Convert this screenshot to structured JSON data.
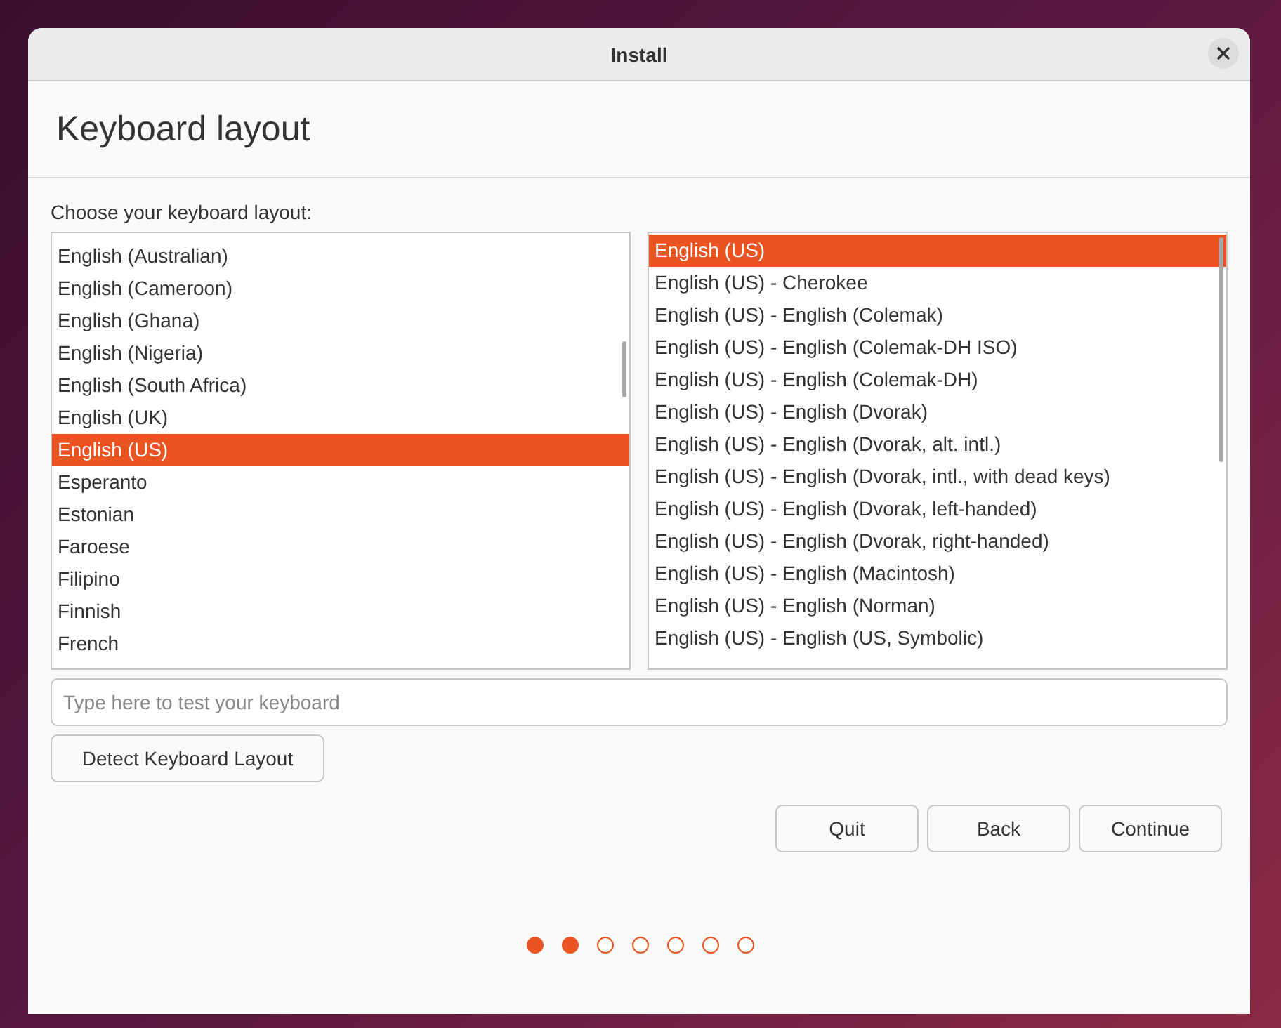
{
  "window": {
    "title": "Install"
  },
  "heading": "Keyboard layout",
  "prompt": "Choose your keyboard layout:",
  "layouts": [
    {
      "label": "English (Australian)",
      "selected": false
    },
    {
      "label": "English (Cameroon)",
      "selected": false
    },
    {
      "label": "English (Ghana)",
      "selected": false
    },
    {
      "label": "English (Nigeria)",
      "selected": false
    },
    {
      "label": "English (South Africa)",
      "selected": false
    },
    {
      "label": "English (UK)",
      "selected": false
    },
    {
      "label": "English (US)",
      "selected": true
    },
    {
      "label": "Esperanto",
      "selected": false
    },
    {
      "label": "Estonian",
      "selected": false
    },
    {
      "label": "Faroese",
      "selected": false
    },
    {
      "label": "Filipino",
      "selected": false
    },
    {
      "label": "Finnish",
      "selected": false
    },
    {
      "label": "French",
      "selected": false
    }
  ],
  "variants": [
    {
      "label": "English (US)",
      "selected": true
    },
    {
      "label": "English (US) - Cherokee",
      "selected": false
    },
    {
      "label": "English (US) - English (Colemak)",
      "selected": false
    },
    {
      "label": "English (US) - English (Colemak-DH ISO)",
      "selected": false
    },
    {
      "label": "English (US) - English (Colemak-DH)",
      "selected": false
    },
    {
      "label": "English (US) - English (Dvorak)",
      "selected": false
    },
    {
      "label": "English (US) - English (Dvorak, alt. intl.)",
      "selected": false
    },
    {
      "label": "English (US) - English (Dvorak, intl., with dead keys)",
      "selected": false
    },
    {
      "label": "English (US) - English (Dvorak, left-handed)",
      "selected": false
    },
    {
      "label": "English (US) - English (Dvorak, right-handed)",
      "selected": false
    },
    {
      "label": "English (US) - English (Macintosh)",
      "selected": false
    },
    {
      "label": "English (US) - English (Norman)",
      "selected": false
    },
    {
      "label": "English (US) - English (US, Symbolic)",
      "selected": false
    }
  ],
  "test_field": {
    "placeholder": "Type here to test your keyboard"
  },
  "detect_button": "Detect Keyboard Layout",
  "buttons": [
    "Quit",
    "Back",
    "Continue"
  ],
  "steps": [
    {
      "done": true
    },
    {
      "done": true
    },
    {
      "done": false
    },
    {
      "done": false
    },
    {
      "done": false
    },
    {
      "done": false
    },
    {
      "done": false
    }
  ]
}
